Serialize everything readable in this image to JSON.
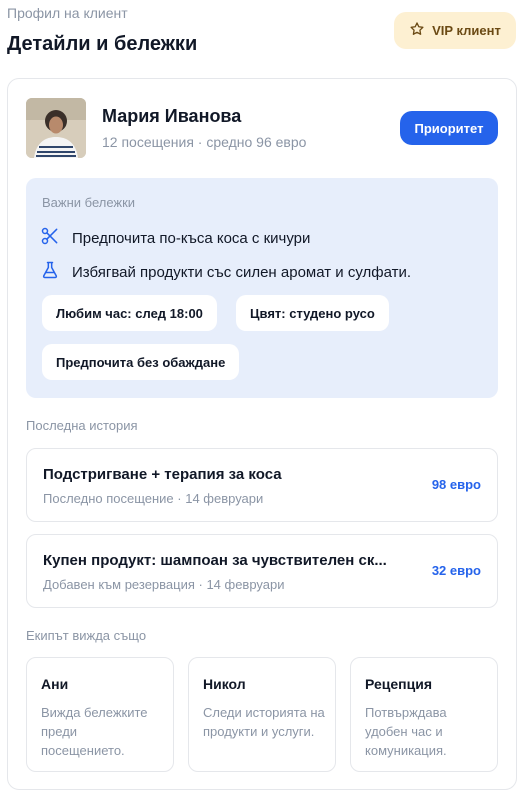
{
  "header": {
    "eyebrow": "Профил на клиент",
    "title": "Детайли и бележки",
    "vip_label": "VIP клиент"
  },
  "client": {
    "name": "Мария Иванова",
    "meta": "12 посещения · средно 96 евро",
    "priority_label": "Приоритет"
  },
  "notes": {
    "title": "Важни бележки",
    "items": [
      {
        "icon": "scissors-icon",
        "text": "Предпочита по-къса коса с кичури"
      },
      {
        "icon": "flask-icon",
        "text": "Избягвай продукти със силен аромат и сулфати."
      }
    ],
    "chips": [
      "Любим час: след 18:00",
      "Цвят: студено русо",
      "Предпочита без обаждане"
    ]
  },
  "history": {
    "title": "Последна история",
    "items": [
      {
        "title": "Подстригване + терапия за коса",
        "subtitle": "Последно посещение · 14 февруари",
        "price": "98 евро"
      },
      {
        "title": "Купен продукт: шампоан за чувствителен ск...",
        "subtitle": "Добавен към резервация · 14 февруари",
        "price": "32 евро"
      }
    ]
  },
  "team": {
    "title": "Екипът вижда също",
    "members": [
      {
        "name": "Ани",
        "desc": "Вижда бележките преди посещението."
      },
      {
        "name": "Никол",
        "desc": "Следи историята на продукти и услуги."
      },
      {
        "name": "Рецепция",
        "desc": "Потвърждава удобен час и комуникация."
      }
    ]
  },
  "colors": {
    "accent": "#2563eb",
    "vip_bg": "#fdf0d2",
    "notes_bg": "#e7eefb"
  }
}
